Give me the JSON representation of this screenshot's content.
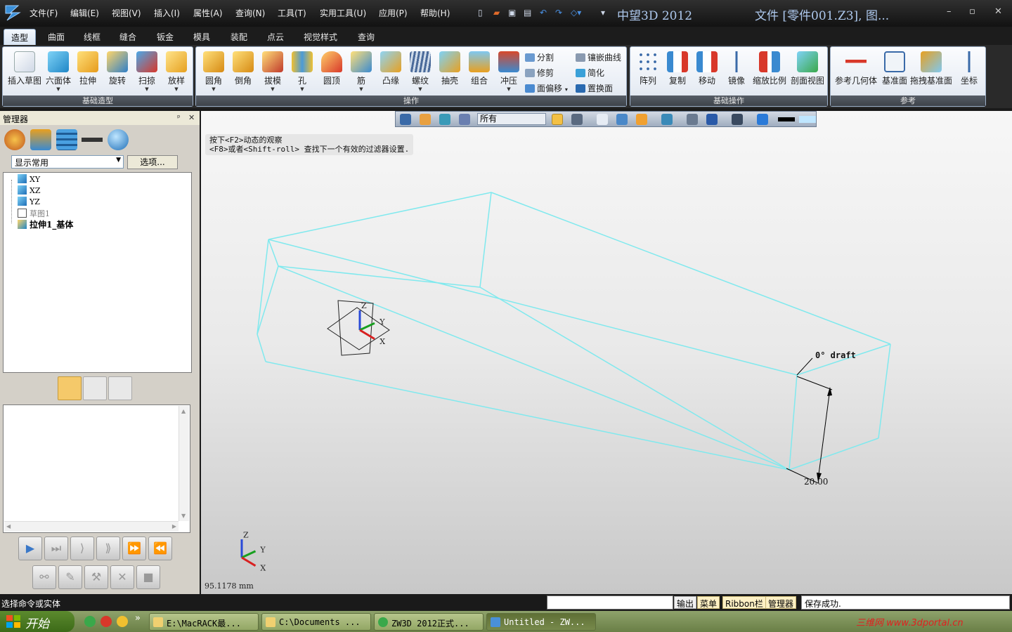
{
  "window": {
    "app_title": "中望3D 2012",
    "doc_title": "文件 [零件001.Z3], 图...",
    "menus": [
      "文件(F)",
      "编辑(E)",
      "视图(V)",
      "插入(I)",
      "属性(A)",
      "查询(N)",
      "工具(T)",
      "实用工具(U)",
      "应用(P)",
      "帮助(H)"
    ],
    "controls": {
      "minimize": "–",
      "restore": "▫",
      "close": "✕"
    }
  },
  "ribbon": {
    "tabs": [
      "造型",
      "曲面",
      "线框",
      "缝合",
      "钣金",
      "模具",
      "装配",
      "点云",
      "视觉样式",
      "查询"
    ],
    "active_tab": "造型",
    "groups": [
      {
        "label": "基础造型",
        "buttons": [
          "插入草图",
          "六面体",
          "拉伸",
          "旋转",
          "扫掠",
          "放样"
        ]
      },
      {
        "label": "操作",
        "buttons": [
          "圆角",
          "倒角",
          "拔模",
          "孔",
          "圆顶",
          "筋",
          "凸缘",
          "螺纹",
          "抽壳",
          "组合",
          "冲压"
        ],
        "small_buttons": [
          "分割",
          "修剪",
          "面偏移",
          "镶嵌曲线",
          "简化",
          "置换面"
        ]
      },
      {
        "label": "基础操作",
        "buttons": [
          "阵列",
          "复制",
          "移动",
          "镜像",
          "缩放比例",
          "剖面视图"
        ]
      },
      {
        "label": "参考",
        "buttons": [
          "参考几何体",
          "基准面",
          "拖拽基准面",
          "坐标"
        ]
      }
    ]
  },
  "manager": {
    "title": "管理器",
    "pin": "ᵖ",
    "close": "✕",
    "filter_value": "显示常用",
    "options_label": "选项...",
    "tree": [
      "XY",
      "XZ",
      "YZ",
      "草图1",
      "拉伸1_基体"
    ]
  },
  "viewport": {
    "filter_value": "所有",
    "hint_lines": [
      "按下<F2>动态的观察",
      "<F8>或者<Shift-roll> 查找下一个有效的过滤器设置."
    ],
    "draft_label": "0° draft",
    "dimension_label": "20.00",
    "axis_labels": {
      "x": "X",
      "y": "Y",
      "z": "Z"
    },
    "coord_readout": "95.1178 mm",
    "wire_color": "#7fe9ee"
  },
  "statusbar": {
    "prompt": "选择命令或实体",
    "tabs": [
      "输出",
      "菜单",
      "Ribbon栏",
      "管理器"
    ],
    "message": "保存成功."
  },
  "taskbar": {
    "start_label": "开始",
    "chevron": "»",
    "tasks": [
      "E:\\MacRACK最...",
      "C:\\Documents ...",
      "ZW3D 2012正式...",
      "Untitled - ZW..."
    ],
    "watermark": "三维网 www.3dportal.cn"
  }
}
